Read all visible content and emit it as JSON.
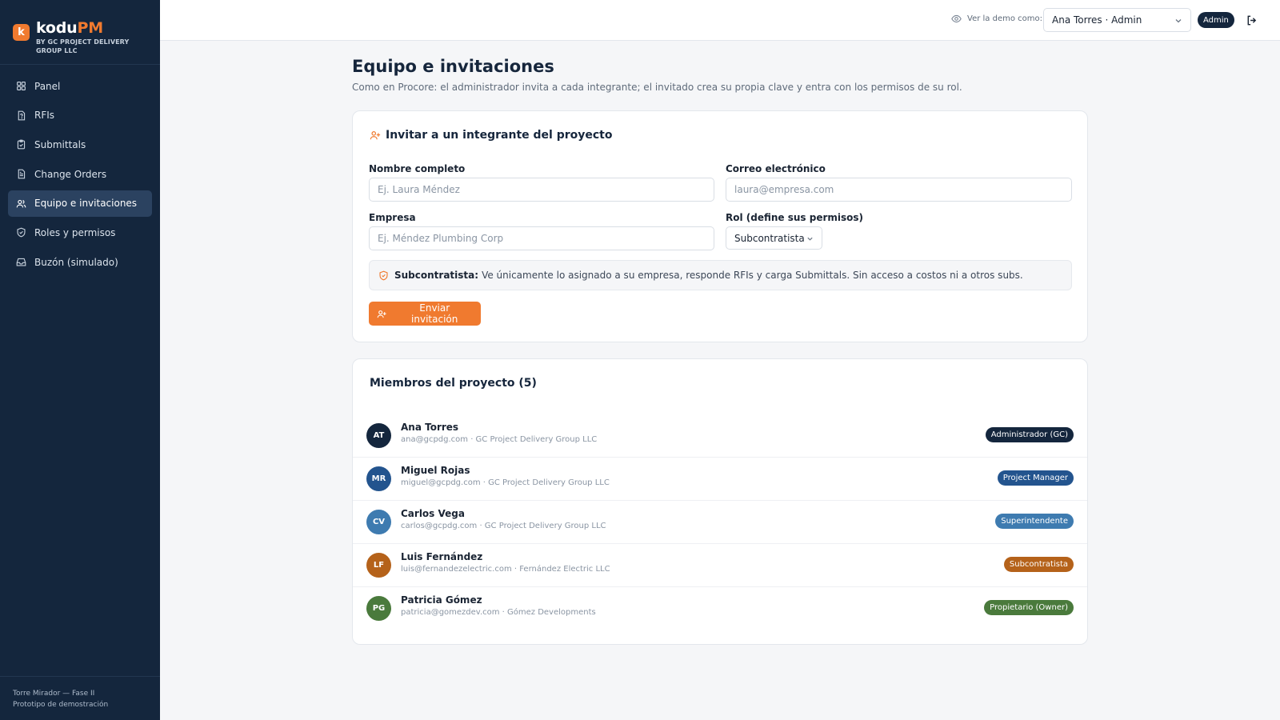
{
  "app": {
    "logo_letter": "k",
    "name_part1": "kodu",
    "name_part2": "PM",
    "subtitle": "BY GC PROJECT DELIVERY GROUP LLC"
  },
  "sidebar": {
    "items": [
      {
        "label": "Panel",
        "icon": "grid-icon"
      },
      {
        "label": "RFIs",
        "icon": "question-doc-icon"
      },
      {
        "label": "Submittals",
        "icon": "clipboard-check-icon"
      },
      {
        "label": "Change Orders",
        "icon": "document-icon"
      },
      {
        "label": "Equipo e invitaciones",
        "icon": "users-icon",
        "active": true
      },
      {
        "label": "Roles y permisos",
        "icon": "shield-check-icon"
      },
      {
        "label": "Buzón (simulado)",
        "icon": "inbox-icon"
      }
    ],
    "footer_project": "Torre Mirador — Fase II",
    "footer_note": "Prototipo de demostración"
  },
  "topbar": {
    "demo_label": "Ver la demo como:",
    "demo_selected": "Ana Torres · Admin",
    "role_badge": "Admin"
  },
  "page": {
    "title": "Equipo e invitaciones",
    "subtitle": "Como en Procore: el administrador invita a cada integrante; el invitado crea su propia clave y entra con los permisos de su rol."
  },
  "invite": {
    "heading": "Invitar a un integrante del proyecto",
    "name_label": "Nombre completo",
    "name_placeholder": "Ej. Laura Méndez",
    "email_label": "Correo electrónico",
    "email_placeholder": "laura@empresa.com",
    "company_label": "Empresa",
    "company_placeholder": "Ej. Méndez Plumbing Corp",
    "role_label": "Rol (define sus permisos)",
    "role_selected": "Subcontratista",
    "role_info_title": "Subcontratista:",
    "role_info_text": "Ve únicamente lo asignado a su empresa, responde RFIs y carga Submittals. Sin acceso a costos ni a otros subs.",
    "send_label": "Enviar invitación"
  },
  "members": {
    "heading": "Miembros del proyecto (5)",
    "list": [
      {
        "initials": "AT",
        "name": "Ana Torres",
        "meta": "ana@gcpdg.com · GC Project Delivery Group LLC",
        "role": "Administrador (GC)",
        "color": "#14263d"
      },
      {
        "initials": "MR",
        "name": "Miguel Rojas",
        "meta": "miguel@gcpdg.com · GC Project Delivery Group LLC",
        "role": "Project Manager",
        "color": "#23548e"
      },
      {
        "initials": "CV",
        "name": "Carlos Vega",
        "meta": "carlos@gcpdg.com · GC Project Delivery Group LLC",
        "role": "Superintendente",
        "color": "#3e7bb0"
      },
      {
        "initials": "LF",
        "name": "Luis Fernández",
        "meta": "luis@fernandezelectric.com · Fernández Electric LLC",
        "role": "Subcontratista",
        "color": "#b5621a"
      },
      {
        "initials": "PG",
        "name": "Patricia Gómez",
        "meta": "patricia@gomezdev.com · Gómez Developments",
        "role": "Propietario (Owner)",
        "color": "#4a7a3c"
      }
    ]
  },
  "colors": {
    "accent": "#f07a2f",
    "sidebar_bg": "#14263d"
  }
}
